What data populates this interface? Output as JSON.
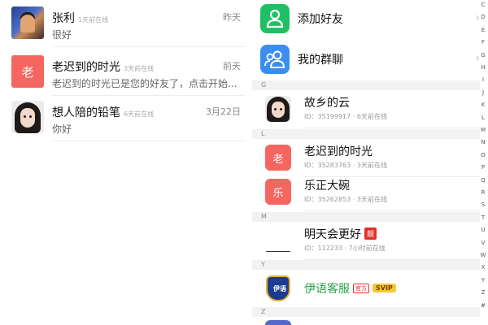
{
  "messages": [
    {
      "name": "张利",
      "online": "1天前在线",
      "preview": "很好",
      "time": "昨天"
    },
    {
      "name": "老迟到的时光",
      "online": "3天前在线",
      "preview": "老迟到的时光已是您的好友了，点击开始...",
      "time": "前天",
      "avatar_text": "老"
    },
    {
      "name": "想人陪的铅笔",
      "online": "6天前在线",
      "preview": "你好",
      "time": "3月22日"
    }
  ],
  "contacts_panel": {
    "top_items": [
      {
        "label": "添加好友",
        "icon": "add-person-icon"
      },
      {
        "label": "我的群聊",
        "icon": "group-chat-icon"
      }
    ],
    "sections": [
      {
        "letter": "G",
        "contacts": [
          {
            "name": "故乡的云",
            "meta": "ID：35199917 · 6天前在线"
          }
        ]
      },
      {
        "letter": "L",
        "contacts": [
          {
            "name": "老迟到的时光",
            "meta": "ID：35283763 · 3天前在线",
            "avatar_text": "老"
          },
          {
            "name": "乐正大碗",
            "meta": "ID：35262853 · 3天前在线",
            "avatar_text": "乐"
          }
        ]
      },
      {
        "letter": "M",
        "contacts": [
          {
            "name": "明天会更好",
            "badge": "靓",
            "meta": "ID：112233 · 7小时前在线"
          }
        ]
      },
      {
        "letter": "Y",
        "contacts": [
          {
            "name": "伊语客服",
            "official": "官方",
            "vip": "SVIP",
            "avatar_text": "伊语"
          }
        ]
      },
      {
        "letter": "Z",
        "contacts": []
      }
    ],
    "index_letters": [
      "C",
      "D",
      "E",
      "F",
      "G",
      "H",
      "I",
      "J",
      "K",
      "L",
      "M",
      "N",
      "O",
      "P",
      "Q",
      "R",
      "S",
      "T",
      "U",
      "V",
      "W",
      "X",
      "Y",
      "Z",
      "#"
    ]
  },
  "colors": {
    "accent_green": "#1fc063",
    "accent_blue": "#3a8ef0",
    "avatar_red": "#f4665f",
    "official_green_name": "#27a146"
  }
}
